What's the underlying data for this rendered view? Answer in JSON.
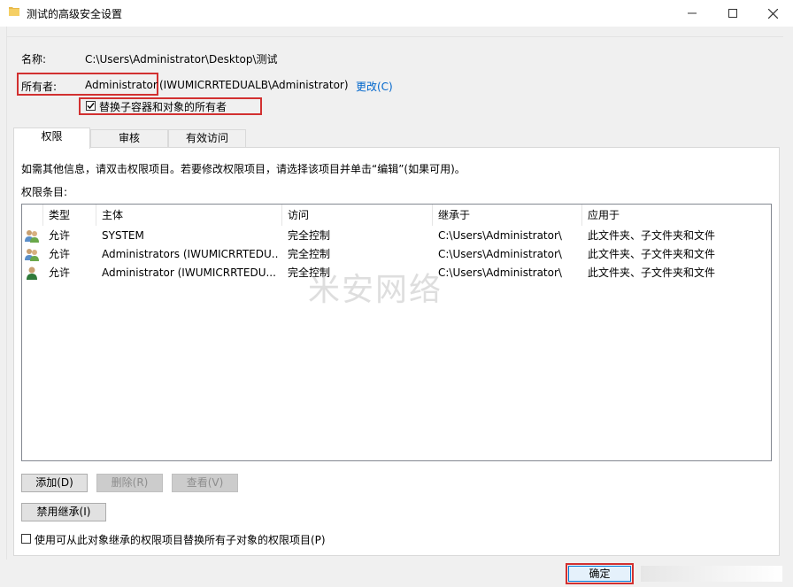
{
  "window": {
    "title": "测试的高级安全设置"
  },
  "name_row": {
    "label": "名称:",
    "value": "C:\\Users\\Administrator\\Desktop\\测试"
  },
  "owner_row": {
    "label": "所有者:",
    "value_name": "Administrator",
    "value_rest": "(IWUMICRRTEDUALB\\Administrator)",
    "change_link": "更改(C)"
  },
  "replace_owner": {
    "label": "替换子容器和对象的所有者",
    "checked": true
  },
  "tabs": [
    {
      "label": "权限",
      "active": true
    },
    {
      "label": "审核",
      "active": false
    },
    {
      "label": "有效访问",
      "active": false
    }
  ],
  "panel": {
    "info_text": "如需其他信息，请双击权限项目。若要修改权限项目，请选择该项目并单击“编辑”(如果可用)。",
    "entries_label": "权限条目:"
  },
  "table": {
    "columns": [
      "类型",
      "主体",
      "访问",
      "继承于",
      "应用于"
    ],
    "rows": [
      {
        "icon": "user-group-icon",
        "type": "允许",
        "principal": "SYSTEM",
        "access": "完全控制",
        "inherited": "C:\\Users\\Administrator\\",
        "applies": "此文件夹、子文件夹和文件"
      },
      {
        "icon": "user-group-icon",
        "type": "允许",
        "principal": "Administrators (IWUMICRRTEDU...",
        "access": "完全控制",
        "inherited": "C:\\Users\\Administrator\\",
        "applies": "此文件夹、子文件夹和文件"
      },
      {
        "icon": "user-icon",
        "type": "允许",
        "principal": "Administrator (IWUMICRRTEDU...",
        "access": "完全控制",
        "inherited": "C:\\Users\\Administrator\\",
        "applies": "此文件夹、子文件夹和文件"
      }
    ]
  },
  "buttons": {
    "add": "添加(D)",
    "remove": "删除(R)",
    "view": "查看(V)",
    "disable_inheritance": "禁用继承(I)",
    "ok": "确定"
  },
  "replace_child": {
    "label": "使用可从此对象继承的权限项目替换所有子对象的权限项目(P)",
    "checked": false
  },
  "watermark": "米安网络",
  "colors": {
    "highlight_red": "#d23030",
    "link_blue": "#0066cc"
  }
}
